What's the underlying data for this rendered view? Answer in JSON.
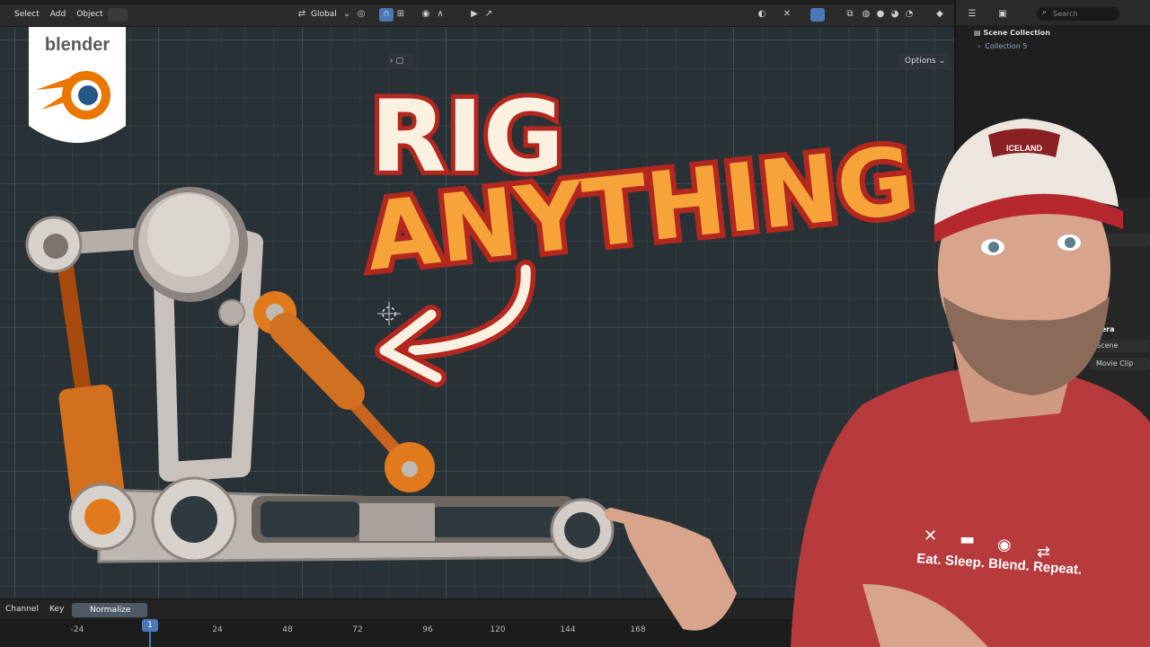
{
  "menubar": {
    "items": [
      "Select",
      "Add",
      "Object"
    ],
    "orientation": "Global"
  },
  "viewport": {
    "options_label": "Options"
  },
  "outliner": {
    "search_placeholder": "Search",
    "scene_collection": "Scene Collection",
    "collection": "Collection 5",
    "props": [
      "nera",
      "Scene",
      "Movie Clip"
    ]
  },
  "timeline": {
    "channel": "Channel",
    "key": "Key",
    "normalize": "Normalize",
    "current_frame": "1",
    "ticks": [
      "-24",
      "24",
      "48",
      "72",
      "96",
      "120",
      "144",
      "168"
    ]
  },
  "thumbnail": {
    "logo_text": "blender",
    "title_line1": "RIG",
    "title_line2": "ANYTHING",
    "cap_text": "ICELAND",
    "shirt_text": "Eat. Sleep. Blend. Repeat."
  },
  "colors": {
    "title_red": "#b3271e",
    "title_orange": "#f6a43a",
    "title_cream": "#fbf1e1",
    "blender_orange": "#ea7600",
    "blender_blue": "#265787",
    "shirt_red": "#b73a3c"
  }
}
